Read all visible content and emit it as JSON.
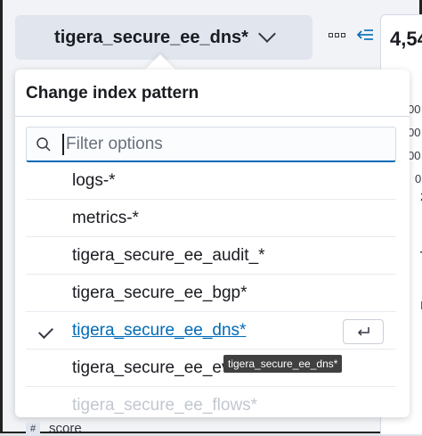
{
  "index_button": {
    "label": "tigera_secure_ee_dns*"
  },
  "toolbar": {
    "more_icon": "more-options-icon",
    "collapse_icon": "collapse-left-icon"
  },
  "right_panel": {
    "count": "4,54",
    "axis_labels": [
      "00",
      "00",
      "00",
      "0",
      "2"
    ],
    "fragments": [
      "T",
      "I"
    ]
  },
  "popover": {
    "title": "Change index pattern",
    "search": {
      "value": "",
      "placeholder": "Filter options"
    },
    "options": [
      {
        "label": "logs-*",
        "selected": false
      },
      {
        "label": "metrics-*",
        "selected": false
      },
      {
        "label": "tigera_secure_ee_audit_*",
        "selected": false
      },
      {
        "label": "tigera_secure_ee_bgp*",
        "selected": false
      },
      {
        "label": "tigera_secure_ee_dns*",
        "selected": true
      },
      {
        "label": "tigera_secure_ee_events*",
        "selected": false
      },
      {
        "label": "tigera_secure_ee_flows*",
        "selected": false
      }
    ]
  },
  "tooltip": {
    "text": "tigera_secure_ee_dns*"
  },
  "field_row": {
    "type_icon": "#",
    "label": "score"
  },
  "colors": {
    "accent": "#006bb8",
    "selected_text": "#006bb8",
    "tooltip_bg": "#404040"
  }
}
